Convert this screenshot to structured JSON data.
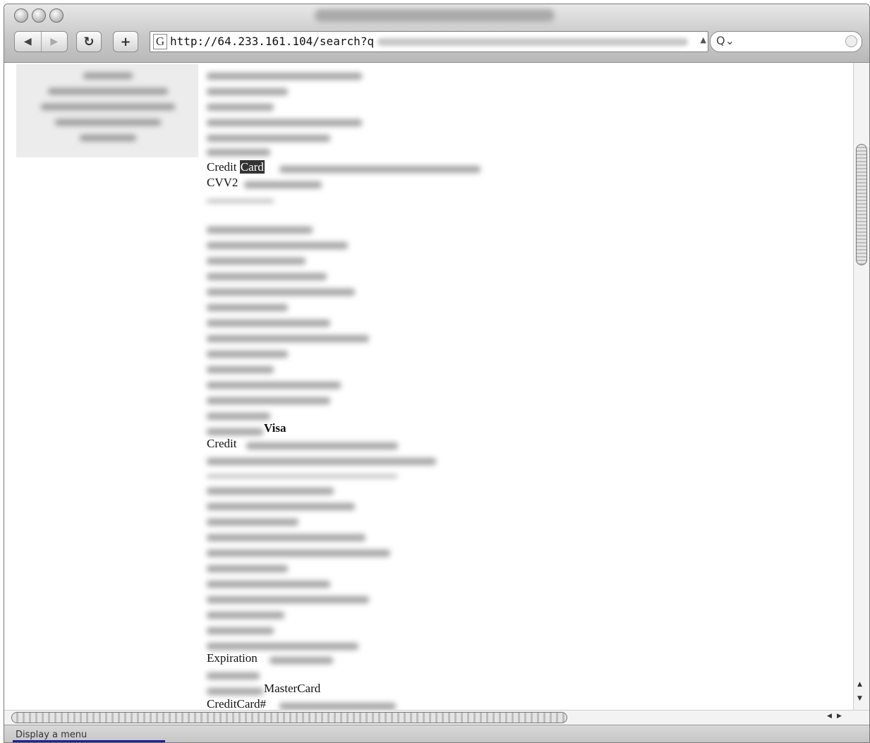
{
  "browser": {
    "url_prefix": "http://64.233.161.104/search?q",
    "search_glyph": "Q⌄",
    "nav_back_glyph": "◀",
    "nav_forward_glyph": "▶",
    "reload_glyph": "↻",
    "add_glyph": "+",
    "google_glyph": "G"
  },
  "records": {
    "credit": "Credit",
    "card_highlight": "Card",
    "cvv2": "CVV2",
    "visa": "Visa",
    "credit2": "Credit",
    "expiration": "Expiration",
    "mastercard": "MasterCard",
    "creditcard_num": "CreditCard#"
  },
  "status": {
    "text": "Display a menu"
  },
  "colors": {
    "highlight_bg": "#333333",
    "status_accent": "#1d1fa0"
  }
}
